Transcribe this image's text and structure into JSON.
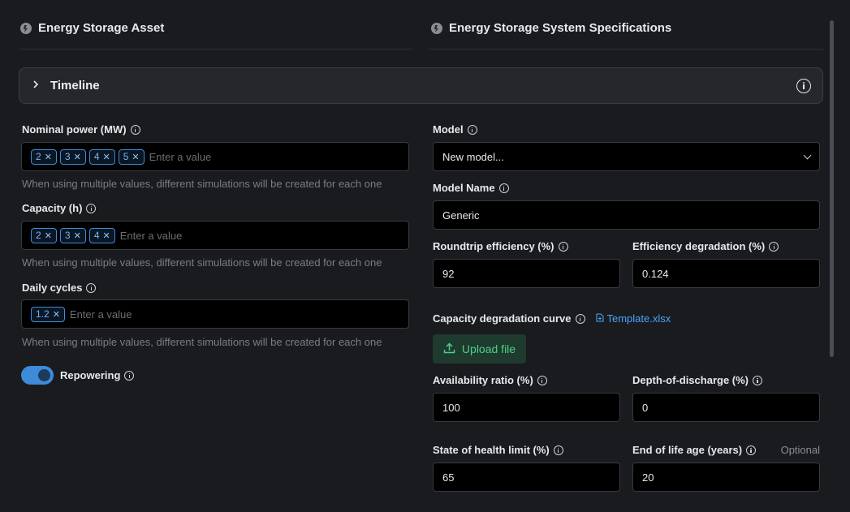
{
  "left": {
    "title": "Energy Storage Asset",
    "nominal_power": {
      "label": "Nominal power (MW)",
      "tags": [
        "2",
        "3",
        "4",
        "5"
      ],
      "placeholder": "Enter a value",
      "hint": "When using multiple values, different simulations will be created for each one"
    },
    "capacity": {
      "label": "Capacity (h)",
      "tags": [
        "2",
        "3",
        "4"
      ],
      "placeholder": "Enter a value",
      "hint": "When using multiple values, different simulations will be created for each one"
    },
    "daily_cycles": {
      "label": "Daily cycles",
      "tags": [
        "1.2"
      ],
      "placeholder": "Enter a value",
      "hint": "When using multiple values, different simulations will be created for each one"
    },
    "repowering": {
      "label": "Repowering",
      "enabled": true
    }
  },
  "timeline": {
    "label": "Timeline"
  },
  "right": {
    "title": "Energy Storage System Specifications",
    "model": {
      "label": "Model",
      "value": "New model..."
    },
    "model_name": {
      "label": "Model Name",
      "value": "Generic"
    },
    "roundtrip_efficiency": {
      "label": "Roundtrip efficiency (%)",
      "value": "92"
    },
    "efficiency_degradation": {
      "label": "Efficiency degradation (%)",
      "value": "0.124"
    },
    "capacity_curve": {
      "label": "Capacity degradation curve",
      "template_link": "Template.xlsx",
      "upload_label": "Upload file"
    },
    "availability_ratio": {
      "label": "Availability ratio (%)",
      "value": "100"
    },
    "depth_of_discharge": {
      "label": "Depth-of-discharge (%)",
      "value": "0"
    },
    "soh_limit": {
      "label": "State of health limit (%)",
      "value": "65"
    },
    "end_of_life": {
      "label": "End of life age (years)",
      "optional": "Optional",
      "value": "20"
    }
  },
  "icons": {
    "section": "battery-asset-icon",
    "info": "info-icon",
    "chevron": "chevron-right-icon",
    "upload": "upload-icon",
    "file": "file-icon"
  },
  "colors": {
    "background": "#1a1b1e",
    "accent": "#3d8bd9",
    "tag_text": "#76b4f5",
    "upload_green": "#4ed086",
    "link": "#4aa3ff"
  }
}
